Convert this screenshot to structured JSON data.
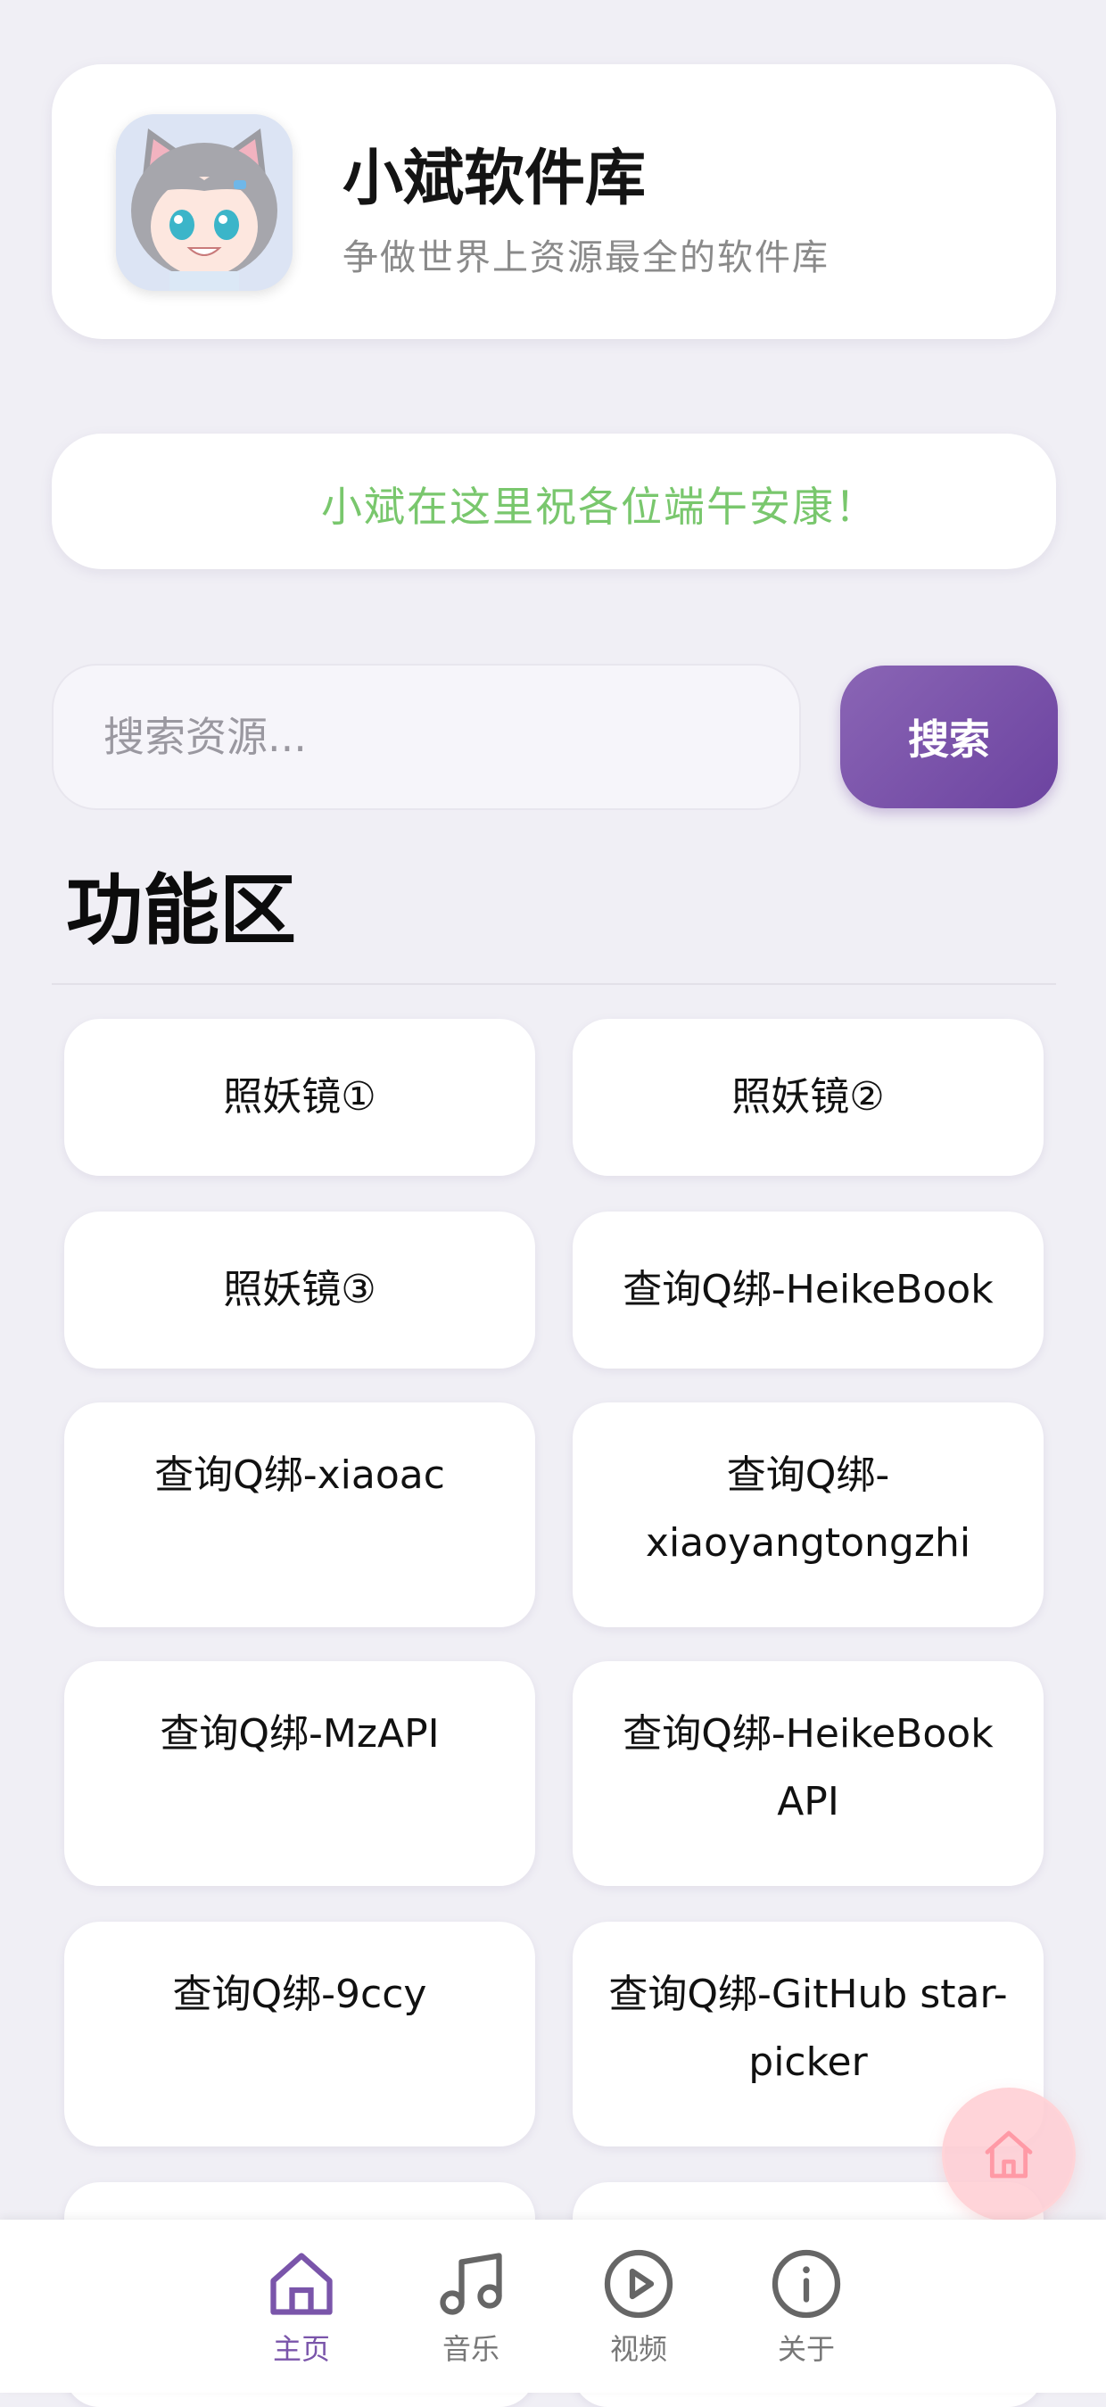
{
  "header": {
    "title": "小斌软件库",
    "subtitle": "争做世界上资源最全的软件库",
    "avatar": "anime-cat-girl-avatar"
  },
  "announcement": {
    "text": "小斌在这里祝各位端午安康！"
  },
  "search": {
    "placeholder": "搜索资源...",
    "button_label": "搜索"
  },
  "section": {
    "title": "功能区"
  },
  "functions": [
    {
      "label": "照妖镜①"
    },
    {
      "label": "照妖镜②"
    },
    {
      "label": "照妖镜③"
    },
    {
      "label": "查询Q绑-HeikeBook"
    },
    {
      "label": "查询Q绑-xiaoac"
    },
    {
      "label": "查询Q绑-xiaoyangtongzhi"
    },
    {
      "label": "查询Q绑-MzAPI"
    },
    {
      "label": "查询Q绑-HeikeBook API"
    },
    {
      "label": "查询Q绑-9ccy"
    },
    {
      "label": "查询Q绑-GitHub star-picker"
    }
  ],
  "fab": {
    "icon": "home-icon"
  },
  "bottom_nav": [
    {
      "label": "主页",
      "icon": "home-icon",
      "active": true
    },
    {
      "label": "音乐",
      "icon": "music-note-icon",
      "active": false
    },
    {
      "label": "视频",
      "icon": "play-circle-icon",
      "active": false
    },
    {
      "label": "关于",
      "icon": "info-icon",
      "active": false
    }
  ],
  "colors": {
    "accent": "#6c43a0",
    "announcement": "#79c76d",
    "background": "#f0eff5",
    "fab": "#ffcdd2"
  }
}
